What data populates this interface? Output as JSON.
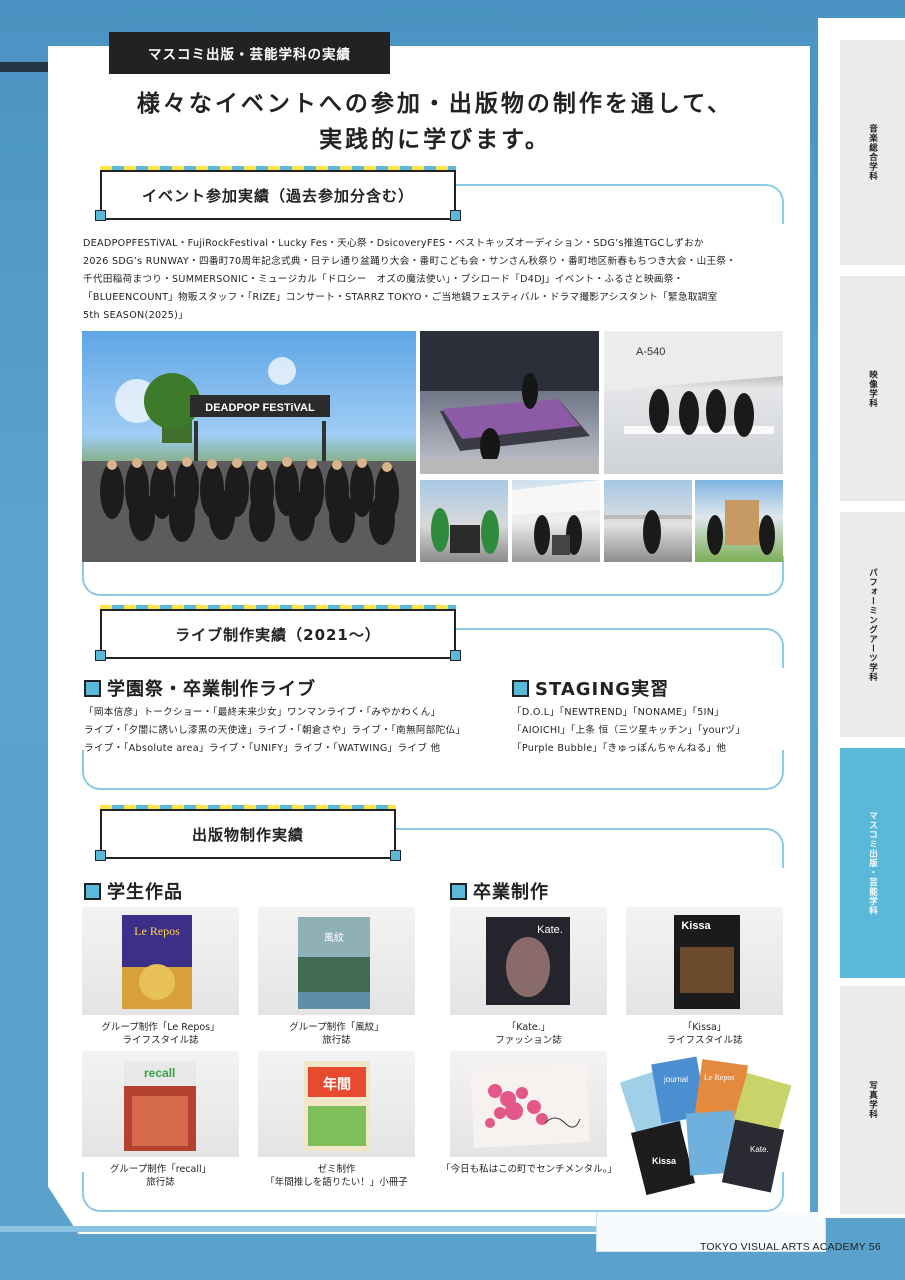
{
  "header": {
    "dept_label": "マスコミ出版・芸能学科の実績",
    "headline_line1": "様々なイベントへの参加・出版物の制作を通して、",
    "headline_line2": "実践的に学びます。"
  },
  "side_tabs": [
    {
      "label": "音楽総合学科",
      "active": false
    },
    {
      "label": "映像学科",
      "active": false
    },
    {
      "label": "パフォーミングアーツ学科",
      "active": false
    },
    {
      "label": "マスコミ出版・芸能学科",
      "active": true
    },
    {
      "label": "写真学科",
      "active": false
    }
  ],
  "events": {
    "title": "イベント参加実績（過去参加分含む）",
    "line1": "DEADPOPFESTiVAL・FujiRockFestival・Lucky Fes・天心祭・DsicoveryFES・ベストキッズオーディション・SDG’s推進TGCしずおか",
    "line2": "2026 SDG’s RUNWAY・四番町70周年記念式典・日テレ通り盆踊り大会・番町こども会・サンさん秋祭り・番町地区新春もちつき大会・山王祭・",
    "line3": "千代田稲荷まつり・SUMMERSONIC・ミュージカル「ドロシー　オズの魔法使い」・ブシロード「D4DJ」イベント・ふるさと映画祭・",
    "line4": "「BLUEENCOUNT」物販スタッフ・「RIZE」コンサート・STARRZ TOKYO・ご当地鍋フェスティバル・ドラマ撮影アシスタント「緊急取調室",
    "line5": "5th SEASON(2025)」",
    "banner_text": "DEADPOP FESTiVAL",
    "sign_text": "A-540"
  },
  "live": {
    "title": "ライブ制作実績（2021～）",
    "school": {
      "heading": "学園祭・卒業制作ライブ",
      "line1": "「岡本信彦」トークショー・「最終未来少女」ワンマンライブ・「みやかわくん」",
      "line2": "ライブ・「夕闇に誘いし漆黒の天使達」ライブ・「朝倉さや」ライブ・「南無阿部陀仏」",
      "line3": "ライブ・「Absolute area」ライブ・「UNIFY」ライブ・「WATWING」ライブ 他"
    },
    "staging": {
      "heading": "STAGING実習",
      "line1": "「D.O.L」「NEWTREND」「NONAME」「5IN」",
      "line2": "「AIOICHI」「上条 恒（三ツ星キッチン」「yourヅ」",
      "line3": "「Purple Bubble」「きゅっぽんちゃんねる」他"
    }
  },
  "publications": {
    "title": "出版物制作実績",
    "student": {
      "heading": "学生作品",
      "items": [
        {
          "cover": "Le Repos",
          "cap1": "グループ制作「Le Repos」",
          "cap2": "ライフスタイル誌"
        },
        {
          "cover": "風紋",
          "cap1": "グループ制作「風紋」",
          "cap2": "旅行誌"
        },
        {
          "cover": "recall",
          "cap1": "グループ制作「recall」",
          "cap2": "旅行誌"
        },
        {
          "cover": "年間",
          "cap1": "ゼミ制作",
          "cap2": "「年間推しを語りたい！」小冊子"
        }
      ]
    },
    "graduate": {
      "heading": "卒業制作",
      "items": [
        {
          "cover": "Kate.",
          "cap1": "「Kate.」",
          "cap2": "ファッション誌"
        },
        {
          "cover": "Kissa",
          "cap1": "「Kissa」",
          "cap2": "ライフスタイル誌"
        },
        {
          "cover": "",
          "cap1": "「今日も私はこの町でセンチメンタル。」",
          "cap2": ""
        }
      ],
      "pile_covers": [
        "Kissa",
        "Kate.",
        "journal",
        "Le Repos"
      ]
    }
  },
  "footer": {
    "text": "TOKYO VISUAL ARTS ACADEMY 56"
  },
  "colors": {
    "accent": "#5ab8d9",
    "yellow": "#ffe14a",
    "dark": "#222222",
    "bg": "#4f97c4"
  }
}
